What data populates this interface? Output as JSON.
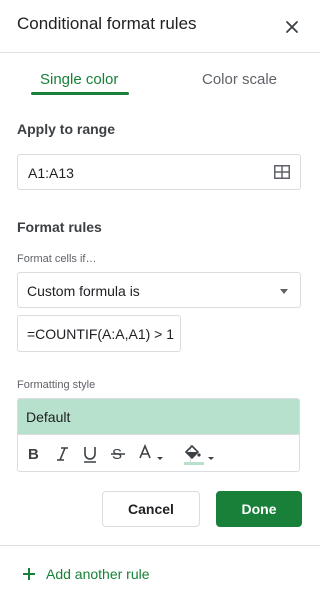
{
  "panel": {
    "title": "Conditional format rules"
  },
  "tabs": [
    {
      "label": "Single color",
      "active": true
    },
    {
      "label": "Color scale",
      "active": false
    }
  ],
  "apply_range": {
    "label": "Apply to range",
    "value": "A1:A13"
  },
  "format_rules": {
    "label": "Format rules",
    "condition_label": "Format cells if…",
    "condition_value": "Custom formula is",
    "formula_value": "=COUNTIF(A:A,A1) > 1"
  },
  "formatting_style": {
    "label": "Formatting style",
    "preview_text": "Default",
    "preview_color": "#b7e1cd",
    "fill_underline_color": "#b7e1cd"
  },
  "buttons": {
    "cancel": "Cancel",
    "done": "Done"
  },
  "footer": {
    "add_rule": "Add another rule"
  },
  "colors": {
    "accent": "#188038",
    "text": "#202124",
    "secondary": "#5f6368",
    "border": "#dadce0"
  }
}
